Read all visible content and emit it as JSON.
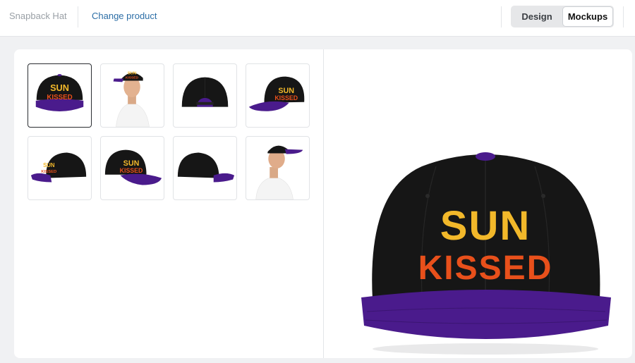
{
  "header": {
    "product_name": "Snapback Hat",
    "change_product_label": "Change product",
    "tabs": [
      {
        "label": "Design",
        "active": false
      },
      {
        "label": "Mockups",
        "active": true
      }
    ]
  },
  "design": {
    "line1": "SUN",
    "line2": "KISSED",
    "colors": {
      "cap_crown": "#161616",
      "cap_brim": "#4a1b8c",
      "text_line1": "#f2b82a",
      "text_line2": "#e8501b",
      "accent_link": "#2c6ea6"
    }
  },
  "mockups": {
    "thumbnails": [
      {
        "name": "front",
        "selected": true
      },
      {
        "name": "model-front",
        "selected": false
      },
      {
        "name": "back",
        "selected": false
      },
      {
        "name": "front-right",
        "selected": false
      },
      {
        "name": "left-side",
        "selected": false
      },
      {
        "name": "front-left",
        "selected": false
      },
      {
        "name": "right-side",
        "selected": false
      },
      {
        "name": "model-back",
        "selected": false
      }
    ]
  }
}
